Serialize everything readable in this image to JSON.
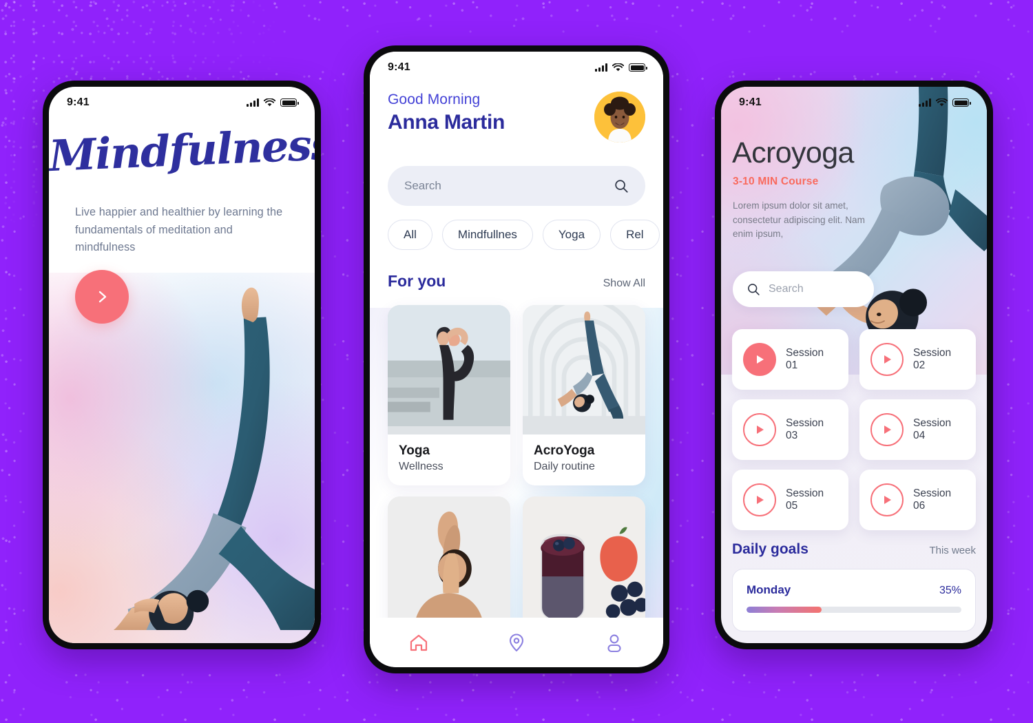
{
  "background": {
    "color": "#9022FB"
  },
  "colors": {
    "purple_bg": "#9022FB",
    "coral": "#F77079",
    "indigo": "#2B2B9C",
    "accent_blue": "#4341D6",
    "avatar_yellow": "#FDC13A"
  },
  "phone1": {
    "status": {
      "time": "9:41",
      "signal_icon": "cellular-bars-icon",
      "wifi_icon": "wifi-icon",
      "battery_icon": "battery-icon"
    },
    "title": "Mindfulness",
    "subtitle": "Live happier and healthier by learning the fundamentals of meditation and mindfulness",
    "cta": {
      "icon": "chevron-right-icon",
      "label": ""
    },
    "hero_image_alt": "woman in wheel yoga pose"
  },
  "phone2": {
    "status": {
      "time": "9:41",
      "signal_icon": "cellular-bars-icon",
      "wifi_icon": "wifi-icon",
      "battery_icon": "battery-icon"
    },
    "greeting": "Good Morning",
    "user_name": "Anna Martin",
    "avatar_alt": "Anna Martin profile photo",
    "search": {
      "placeholder": "Search",
      "icon": "search-icon"
    },
    "chips": [
      "All",
      "Mindfullnes",
      "Yoga",
      "Rel"
    ],
    "section": {
      "title": "For you",
      "action": "Show All"
    },
    "cards": [
      {
        "title": "Yoga",
        "subtitle": "Wellness",
        "image_alt": "woman in dancer pose on steps"
      },
      {
        "title": "AcroYoga",
        "subtitle": "Daily routine",
        "image_alt": "woman in bridge pose in white corridor"
      },
      {
        "title": "",
        "subtitle": "",
        "image_alt": "woman in prayer pose from behind"
      },
      {
        "title": "",
        "subtitle": "",
        "image_alt": "berry smoothie bowl with apple and blueberries"
      }
    ],
    "nav": [
      {
        "name": "home",
        "icon": "home-icon",
        "active": true
      },
      {
        "name": "explore",
        "icon": "location-pin-icon",
        "active": false
      },
      {
        "name": "profile",
        "icon": "user-icon",
        "active": false
      }
    ]
  },
  "phone3": {
    "status": {
      "time": "9:41",
      "signal_icon": "cellular-bars-icon",
      "wifi_icon": "wifi-icon",
      "battery_icon": "battery-icon"
    },
    "title": "Acroyoga",
    "course_label": "3-10 MIN Course",
    "description": "Lorem ipsum dolor sit amet, consectetur adipiscing elit. Nam enim ipsum,",
    "search": {
      "placeholder": "Search",
      "icon": "search-icon"
    },
    "sessions": [
      {
        "label": "Session 01",
        "icon": "play-icon",
        "active": true
      },
      {
        "label": "Session 02",
        "icon": "play-icon",
        "active": false
      },
      {
        "label": "Session 03",
        "icon": "play-icon",
        "active": false
      },
      {
        "label": "Session 04",
        "icon": "play-icon",
        "active": false
      },
      {
        "label": "Session 05",
        "icon": "play-icon",
        "active": false
      },
      {
        "label": "Session 06",
        "icon": "play-icon",
        "active": false
      }
    ],
    "goals": {
      "title": "Daily goals",
      "range": "This week",
      "day": "Monday",
      "percent_label": "35%",
      "percent_value": 35
    },
    "hero_image_alt": "woman in standing split backbend"
  }
}
